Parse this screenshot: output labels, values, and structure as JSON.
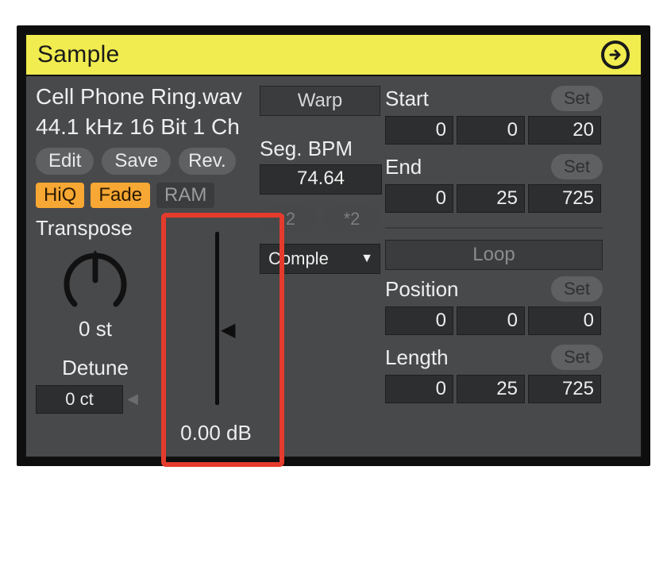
{
  "title": "Sample",
  "file": {
    "name": "Cell Phone Ring.wav",
    "info": "44.1 kHz 16 Bit 1 Ch"
  },
  "buttons": {
    "edit": "Edit",
    "save": "Save",
    "rev": "Rev.",
    "hiq": "HiQ",
    "fade": "Fade",
    "ram": "RAM"
  },
  "transpose": {
    "label": "Transpose",
    "value": "0 st"
  },
  "detune": {
    "label": "Detune",
    "value": "0 ct"
  },
  "gain": {
    "value": "0.00 dB"
  },
  "warp": {
    "label": "Warp",
    "seg_label": "Seg. BPM",
    "seg_value": "74.64",
    "half": ":2",
    "double": "*2",
    "mode": "Comple"
  },
  "start": {
    "label": "Start",
    "set": "Set",
    "v1": "0",
    "v2": "0",
    "v3": "20"
  },
  "end": {
    "label": "End",
    "set": "Set",
    "v1": "0",
    "v2": "25",
    "v3": "725"
  },
  "loop": {
    "label": "Loop"
  },
  "position": {
    "label": "Position",
    "set": "Set",
    "v1": "0",
    "v2": "0",
    "v3": "0"
  },
  "length": {
    "label": "Length",
    "set": "Set",
    "v1": "0",
    "v2": "25",
    "v3": "725"
  }
}
